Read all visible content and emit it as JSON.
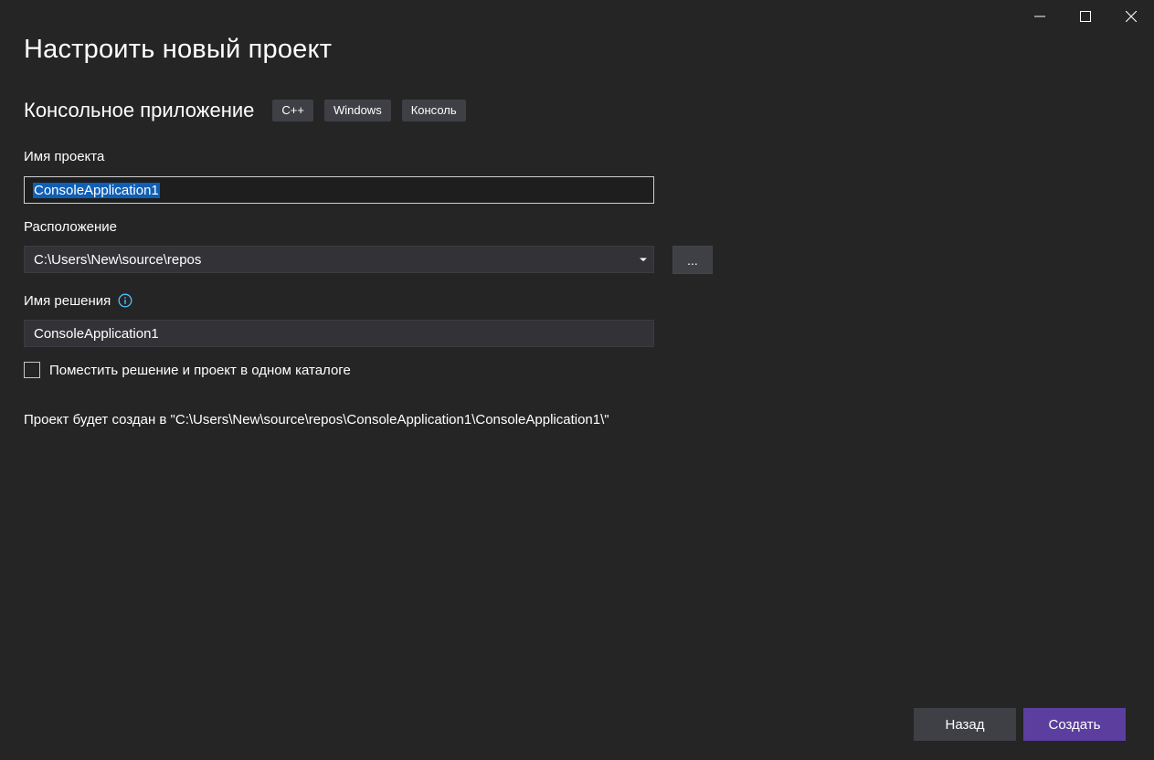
{
  "window": {
    "controls": [
      "minimize-icon",
      "maximize-icon",
      "close-icon"
    ]
  },
  "header": {
    "title": "Настроить новый проект"
  },
  "template": {
    "name": "Консольное приложение",
    "tags": [
      "C++",
      "Windows",
      "Консоль"
    ]
  },
  "form": {
    "project_name": {
      "label": "Имя проекта",
      "value": "ConsoleApplication1"
    },
    "location": {
      "label": "Расположение",
      "value": "C:\\Users\\New\\source\\repos",
      "browse_label": "..."
    },
    "solution_name": {
      "label": "Имя решения",
      "value": "ConsoleApplication1",
      "info_icon": "info-icon"
    },
    "same_dir": {
      "label": "Поместить решение и проект в одном каталоге",
      "checked": false
    },
    "path_info": "Проект будет создан в \"C:\\Users\\New\\source\\repos\\ConsoleApplication1\\ConsoleApplication1\\\""
  },
  "footer": {
    "back_label": "Назад",
    "create_label": "Создать"
  },
  "colors": {
    "background": "#252526",
    "accent": "#5b3e9e",
    "selection": "#0e5fb5",
    "info": "#4fc1ff"
  }
}
